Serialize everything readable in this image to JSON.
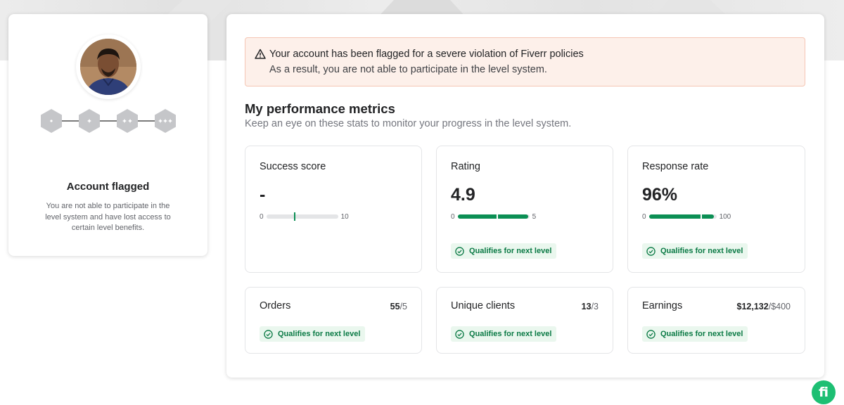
{
  "profile": {
    "status_title": "Account flagged",
    "status_desc": "You are not able to participate in the level system and have lost access to certain level benefits."
  },
  "alert": {
    "title": "Your account has been flagged for a severe violation of Fiverr policies",
    "subtitle": "As a result, you are not able to participate in the level system."
  },
  "section": {
    "title": "My performance metrics",
    "subtitle": "Keep an eye on these stats to monitor your progress in the level system."
  },
  "metrics": {
    "success": {
      "label": "Success score",
      "value": "-",
      "min": "0",
      "max": "10",
      "threshold": 0.4
    },
    "rating": {
      "label": "Rating",
      "value": "4.9",
      "min": "0",
      "max": "5",
      "fill": 0.98,
      "threshold": 0.55,
      "qualify": "Qualifies for next level"
    },
    "response": {
      "label": "Response rate",
      "value": "96%",
      "min": "0",
      "max": "100",
      "fill": 0.96,
      "threshold": 0.78,
      "qualify": "Qualifies for next level"
    },
    "orders": {
      "label": "Orders",
      "current": "55",
      "target": "/5",
      "qualify": "Qualifies for next level"
    },
    "clients": {
      "label": "Unique clients",
      "current": "13",
      "target": "/3",
      "qualify": "Qualifies for next level"
    },
    "earnings": {
      "label": "Earnings",
      "current": "$12,132",
      "target": "/$400",
      "qualify": "Qualifies for next level"
    }
  },
  "fab": {
    "label": "fi"
  },
  "colors": {
    "accent": "#1dbf73",
    "accent_dark": "#0b8f54",
    "alert_bg": "#fdf0ea"
  }
}
